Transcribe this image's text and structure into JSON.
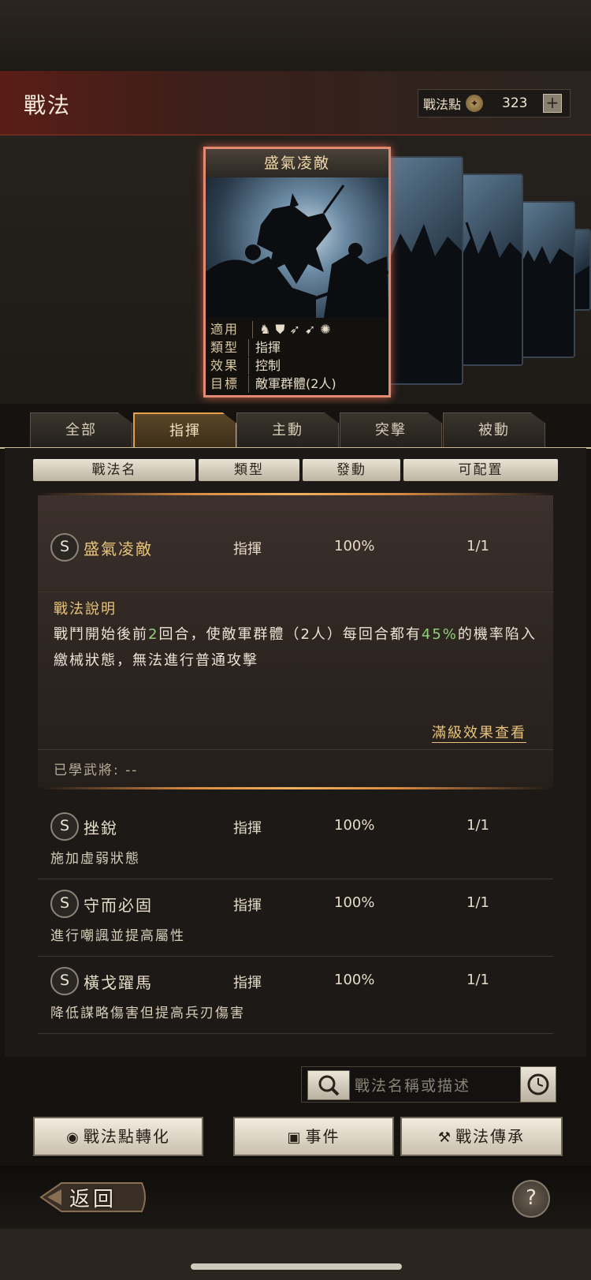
{
  "header": {
    "title": "戰法"
  },
  "points": {
    "label": "戰法點",
    "coin_icon": "coin-icon",
    "value": "323",
    "plus": "+"
  },
  "card": {
    "title": "盛氣凌敵",
    "applicable_label": "適用",
    "applicable_icons": [
      "cavalry-icon",
      "shield-icon",
      "bow-icon",
      "spear-icon",
      "wheel-icon"
    ],
    "type_label": "類型",
    "type_value": "指揮",
    "effect_label": "效果",
    "effect_value": "控制",
    "target_label": "目標",
    "target_value": "敵軍群體(2人)"
  },
  "tabs": [
    "全部",
    "指揮",
    "主動",
    "突擊",
    "被動"
  ],
  "active_tab": "指揮",
  "columns": [
    "戰法名",
    "類型",
    "發動",
    "可配置"
  ],
  "selected": {
    "grade": "S",
    "name": "盛氣凌敵",
    "type": "指揮",
    "rate": "100%",
    "slots": "1/1",
    "desc_title": "戰法說明",
    "desc_p1": "戰鬥開始後前",
    "desc_num1": "2",
    "desc_p2": "回合，使敵軍群體（2人）每回合都有",
    "desc_num2": "45%",
    "desc_p3": "的機率陷入繳械狀態，無法進行普通攻擊",
    "max_link": "滿級效果查看",
    "learned": "已學武將: --"
  },
  "rows": [
    {
      "grade": "S",
      "name": "挫銳",
      "type": "指揮",
      "rate": "100%",
      "slots": "1/1",
      "desc": "施加虛弱狀態"
    },
    {
      "grade": "S",
      "name": "守而必固",
      "type": "指揮",
      "rate": "100%",
      "slots": "1/1",
      "desc": "進行嘲諷並提高屬性"
    },
    {
      "grade": "S",
      "name": "橫戈躍馬",
      "type": "指揮",
      "rate": "100%",
      "slots": "1/1",
      "desc": "降低謀略傷害但提高兵刃傷害"
    }
  ],
  "search": {
    "placeholder": "戰法名稱或描述"
  },
  "buttons": {
    "convert": "戰法點轉化",
    "event": "事件",
    "inherit": "戰法傳承"
  },
  "footer": {
    "back": "返回",
    "help": "?"
  },
  "colors": {
    "accent": "#e8c47a",
    "highlight": "#8fd07a",
    "tab_active_border": "#e8a04a",
    "card_border": "#e28a72"
  }
}
